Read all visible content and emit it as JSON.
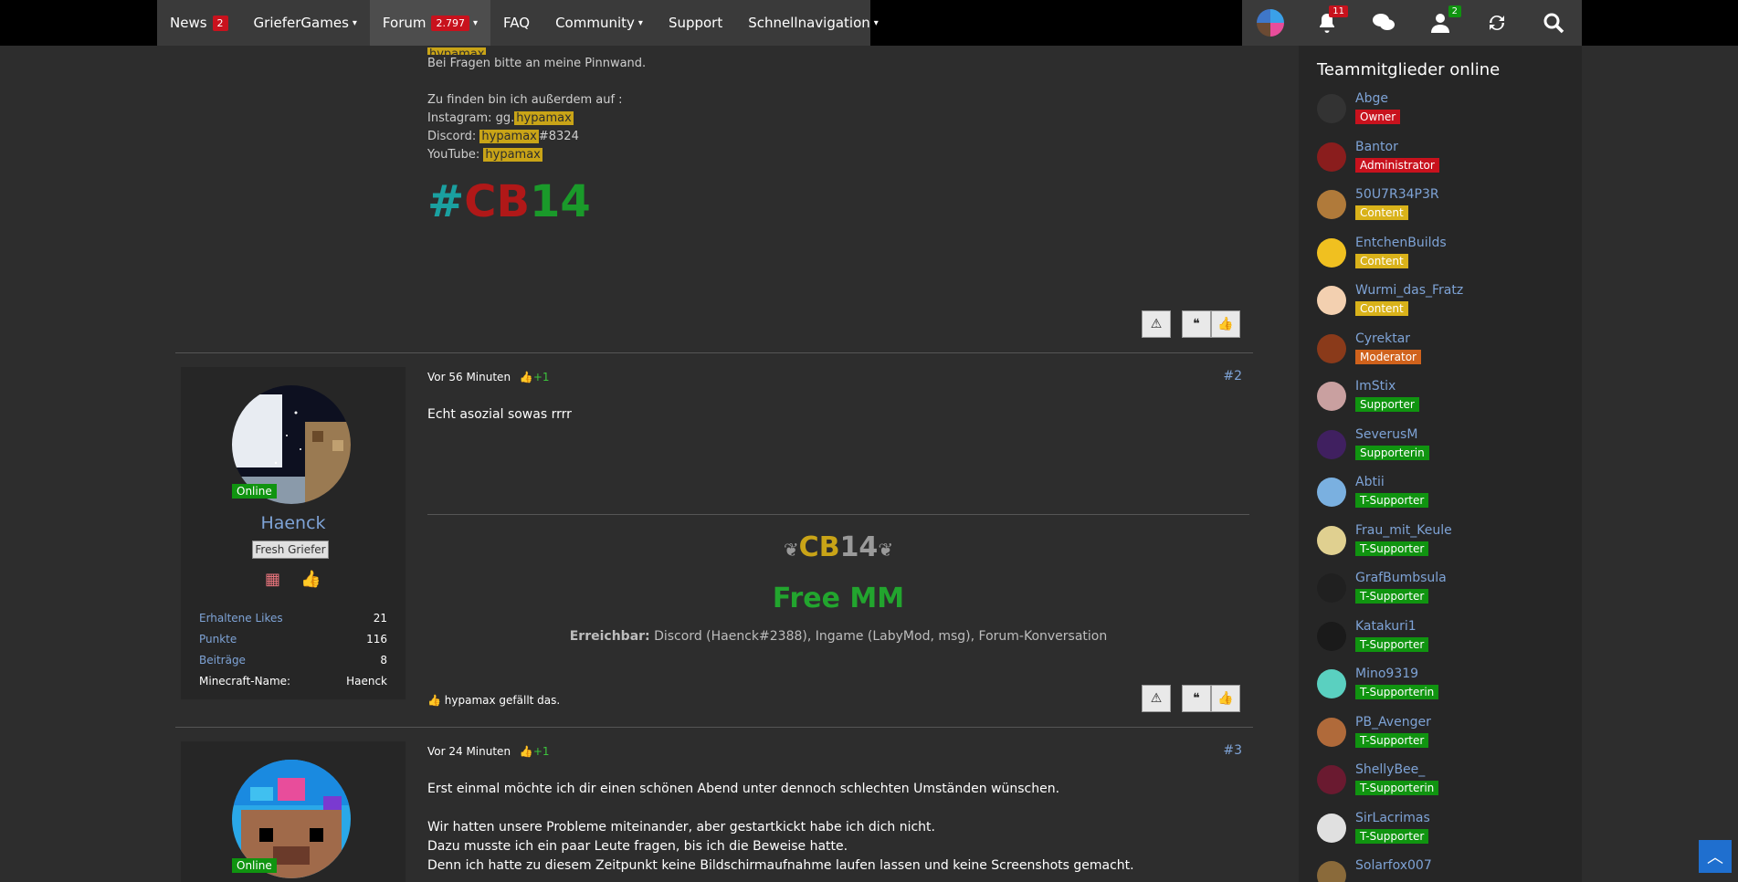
{
  "nav": {
    "items": [
      {
        "label": "News",
        "badge": "2"
      },
      {
        "label": "GrieferGames"
      },
      {
        "label": "Forum",
        "badge": "2.797"
      },
      {
        "label": "FAQ"
      },
      {
        "label": "Community"
      },
      {
        "label": "Support"
      },
      {
        "label": "Schnellnavigation"
      }
    ],
    "notifications_badge": "11",
    "friends_badge": "2"
  },
  "signature": {
    "line1": "Bei Fragen bitte an meine Pinnwand.",
    "line2": "Zu finden bin ich außerdem auf :",
    "instagram_label": "Instagram: gg.",
    "instagram_handle": "hypamax",
    "discord_label": "Discord: ",
    "discord_handle": "hypamax",
    "discord_tag": "#8324",
    "youtube_label": "YouTube: ",
    "youtube_handle": "hypamax",
    "cb_hash": "#",
    "cb_letters": "CB",
    "cb_number": "14"
  },
  "posts": [
    {
      "time": "Vor 56 Minuten",
      "likes": "+1",
      "number": "#2",
      "author": "Haenck",
      "online": "Online",
      "rank": "Fresh Griefer",
      "stats": [
        {
          "k": "Erhaltene Likes",
          "v": "21"
        },
        {
          "k": "Punkte",
          "v": "116"
        },
        {
          "k": "Beiträge",
          "v": "8"
        },
        {
          "k": "Minecraft-Name:",
          "v": "Haenck"
        }
      ],
      "text": "Echt asozial sowas rrrr",
      "sig_cb": "CB",
      "sig_num": "14",
      "sig_freemm": "Free MM",
      "sig_reach_label": "Erreichbar:",
      "sig_reach": " Discord (Haenck#2388), Ingame (LabyMod, msg), Forum-Konversation",
      "liked_by": "hypamax gefällt das."
    },
    {
      "time": "Vor 24 Minuten",
      "likes": "+1",
      "number": "#3",
      "online": "Online",
      "p1": "Erst einmal möchte ich dir einen schönen Abend unter dennoch schlechten Umständen wünschen.",
      "p2": "Wir hatten unsere Probleme miteinander, aber gestartkickt habe ich dich nicht.",
      "p3": "Dazu musste ich ein paar Leute fragen, bis ich die Beweise hatte.",
      "p4": "Denn ich hatte zu diesem Zeitpunkt keine Bildschirmaufnahme laufen lassen und keine Screenshots gemacht."
    }
  ],
  "sidebar": {
    "title": "Teammitglieder online",
    "members": [
      {
        "name": "Abge",
        "role": "Owner",
        "color": "#c8121d",
        "av": "#333333"
      },
      {
        "name": "Bantor",
        "role": "Administrator",
        "color": "#c8121d",
        "av": "#8a1d1d"
      },
      {
        "name": "50U7R34P3R",
        "role": "Content",
        "color": "#d9b21a",
        "av": "#b07a3a"
      },
      {
        "name": "EntchenBuilds",
        "role": "Content",
        "color": "#d9b21a",
        "av": "#f0c020"
      },
      {
        "name": "Wurmi_das_Fratz",
        "role": "Content",
        "color": "#d9b21a",
        "av": "#f3d0b0"
      },
      {
        "name": "Cyrektar",
        "role": "Moderator",
        "color": "#d0621c",
        "av": "#8a3a1a"
      },
      {
        "name": "ImStix",
        "role": "Supporter",
        "color": "#109410",
        "av": "#c9a0a0"
      },
      {
        "name": "SeverusM",
        "role": "Supporterin",
        "color": "#109410",
        "av": "#402060"
      },
      {
        "name": "Abtii",
        "role": "T-Supporter",
        "color": "#109410",
        "av": "#7ab0e0"
      },
      {
        "name": "Frau_mit_Keule",
        "role": "T-Supporter",
        "color": "#109410",
        "av": "#e0d090"
      },
      {
        "name": "GrafBumbsula",
        "role": "T-Supporter",
        "color": "#109410",
        "av": "#202020"
      },
      {
        "name": "Katakuri1",
        "role": "T-Supporter",
        "color": "#109410",
        "av": "#1a1a1a"
      },
      {
        "name": "Mino9319",
        "role": "T-Supporterin",
        "color": "#109410",
        "av": "#5ad0c0"
      },
      {
        "name": "PB_Avenger",
        "role": "T-Supporter",
        "color": "#109410",
        "av": "#b06a3a"
      },
      {
        "name": "ShellyBee_",
        "role": "T-Supporterin",
        "color": "#109410",
        "av": "#6a1a30"
      },
      {
        "name": "SirLacrimas",
        "role": "T-Supporter",
        "color": "#109410",
        "av": "#e0e0e0"
      },
      {
        "name": "Solarfox007",
        "role": "",
        "color": "#109410",
        "av": "#8a6a3a"
      }
    ]
  }
}
